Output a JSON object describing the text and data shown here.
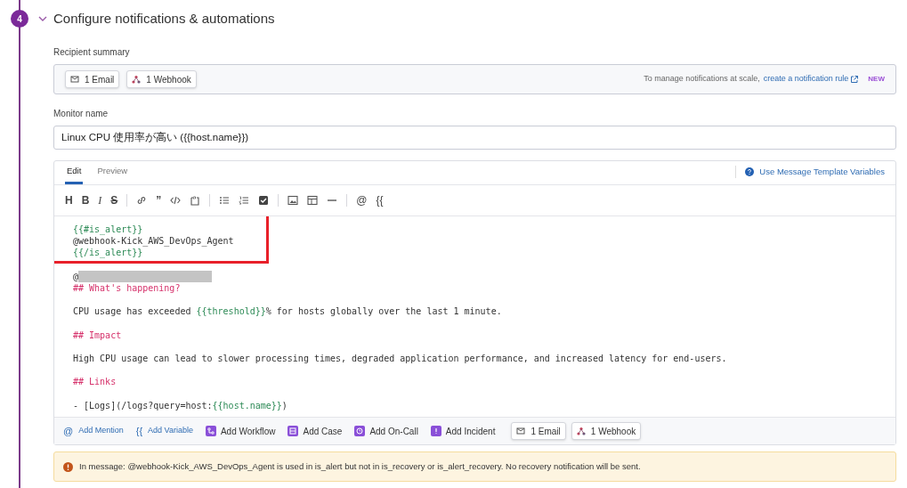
{
  "step": {
    "number": "4",
    "title": "Configure notifications & automations",
    "expanded": true
  },
  "recipient_summary": {
    "label": "Recipient summary",
    "chips": [
      {
        "kind": "email",
        "label": "1 Email"
      },
      {
        "kind": "webhook",
        "label": "1 Webhook"
      }
    ],
    "note": "To manage notifications at scale,",
    "link": "create a notification rule",
    "badge": "NEW"
  },
  "monitor_name": {
    "label": "Monitor name",
    "value": "Linux CPU 使用率が高い ({{host.name}})"
  },
  "editor": {
    "tabs": [
      {
        "label": "Edit",
        "selected": true
      },
      {
        "label": "Preview",
        "selected": false
      }
    ],
    "help_link": "Use Message Template Variables",
    "toolbar": [
      {
        "kind": "heading",
        "label": "H"
      },
      {
        "kind": "bold",
        "label": "B"
      },
      {
        "kind": "italic",
        "label": "I"
      },
      {
        "kind": "strike",
        "label": "S"
      },
      {
        "kind": "sep"
      },
      {
        "kind": "link"
      },
      {
        "kind": "quote",
        "label": "”"
      },
      {
        "kind": "code"
      },
      {
        "kind": "codeblock"
      },
      {
        "kind": "sep"
      },
      {
        "kind": "bullets"
      },
      {
        "kind": "numbers"
      },
      {
        "kind": "check"
      },
      {
        "kind": "sep"
      },
      {
        "kind": "image"
      },
      {
        "kind": "table"
      },
      {
        "kind": "rule"
      },
      {
        "kind": "sep"
      },
      {
        "kind": "mention",
        "label": "@"
      },
      {
        "kind": "variable",
        "label": "{{"
      }
    ],
    "lines": [
      {
        "kind": "text",
        "highlighted": true,
        "segments": [
          {
            "kind": "var",
            "text": "{{#is_alert}}"
          }
        ]
      },
      {
        "kind": "text",
        "highlighted": true,
        "segments": [
          {
            "kind": "plain",
            "text": "@webhook-Kick_AWS_DevOps_Agent"
          }
        ]
      },
      {
        "kind": "text",
        "highlighted": true,
        "segments": [
          {
            "kind": "var",
            "text": "{{/is_alert}}"
          }
        ]
      },
      {
        "kind": "blank"
      },
      {
        "kind": "text",
        "highlighted": false,
        "segments": [
          {
            "kind": "plain",
            "text": "@"
          },
          {
            "kind": "redacted"
          }
        ]
      },
      {
        "kind": "text",
        "highlighted": false,
        "segments": [
          {
            "kind": "heading",
            "text": "## What's happening?"
          }
        ]
      },
      {
        "kind": "blank"
      },
      {
        "kind": "text",
        "highlighted": false,
        "segments": [
          {
            "kind": "plain",
            "text": "CPU usage has exceeded "
          },
          {
            "kind": "var",
            "text": "{{threshold}}"
          },
          {
            "kind": "plain",
            "text": "% for hosts globally over the last 1 minute."
          }
        ]
      },
      {
        "kind": "blank"
      },
      {
        "kind": "text",
        "highlighted": false,
        "segments": [
          {
            "kind": "heading",
            "text": "## Impact"
          }
        ]
      },
      {
        "kind": "blank"
      },
      {
        "kind": "text",
        "highlighted": false,
        "segments": [
          {
            "kind": "plain",
            "text": "High CPU usage can lead to slower processing times, degraded application performance, and increased latency for end-users."
          }
        ]
      },
      {
        "kind": "blank"
      },
      {
        "kind": "text",
        "highlighted": false,
        "segments": [
          {
            "kind": "heading",
            "text": "## Links"
          }
        ]
      },
      {
        "kind": "blank"
      },
      {
        "kind": "text",
        "highlighted": false,
        "segments": [
          {
            "kind": "plain",
            "text": "- [Logs](/logs?query=host:"
          },
          {
            "kind": "var",
            "text": "{{host.name}}"
          },
          {
            "kind": "plain",
            "text": ")"
          }
        ]
      }
    ],
    "actions": [
      {
        "kind": "mention",
        "icon": "@",
        "label": "Add Mention"
      },
      {
        "kind": "variable",
        "icon": "{{",
        "label": "Add Variable"
      },
      {
        "kind": "workflow",
        "label": "Add Workflow"
      },
      {
        "kind": "case",
        "label": "Add Case"
      },
      {
        "kind": "oncall",
        "label": "Add On-Call"
      },
      {
        "kind": "incident",
        "label": "Add Incident"
      }
    ],
    "chips": [
      {
        "kind": "email",
        "label": "1 Email"
      },
      {
        "kind": "webhook",
        "label": "1 Webhook"
      }
    ]
  },
  "warning": "In message: @webhook-Kick_AWS_DevOps_Agent is used in is_alert but not in is_recovery or is_alert_recovery. No recovery notification will be sent."
}
